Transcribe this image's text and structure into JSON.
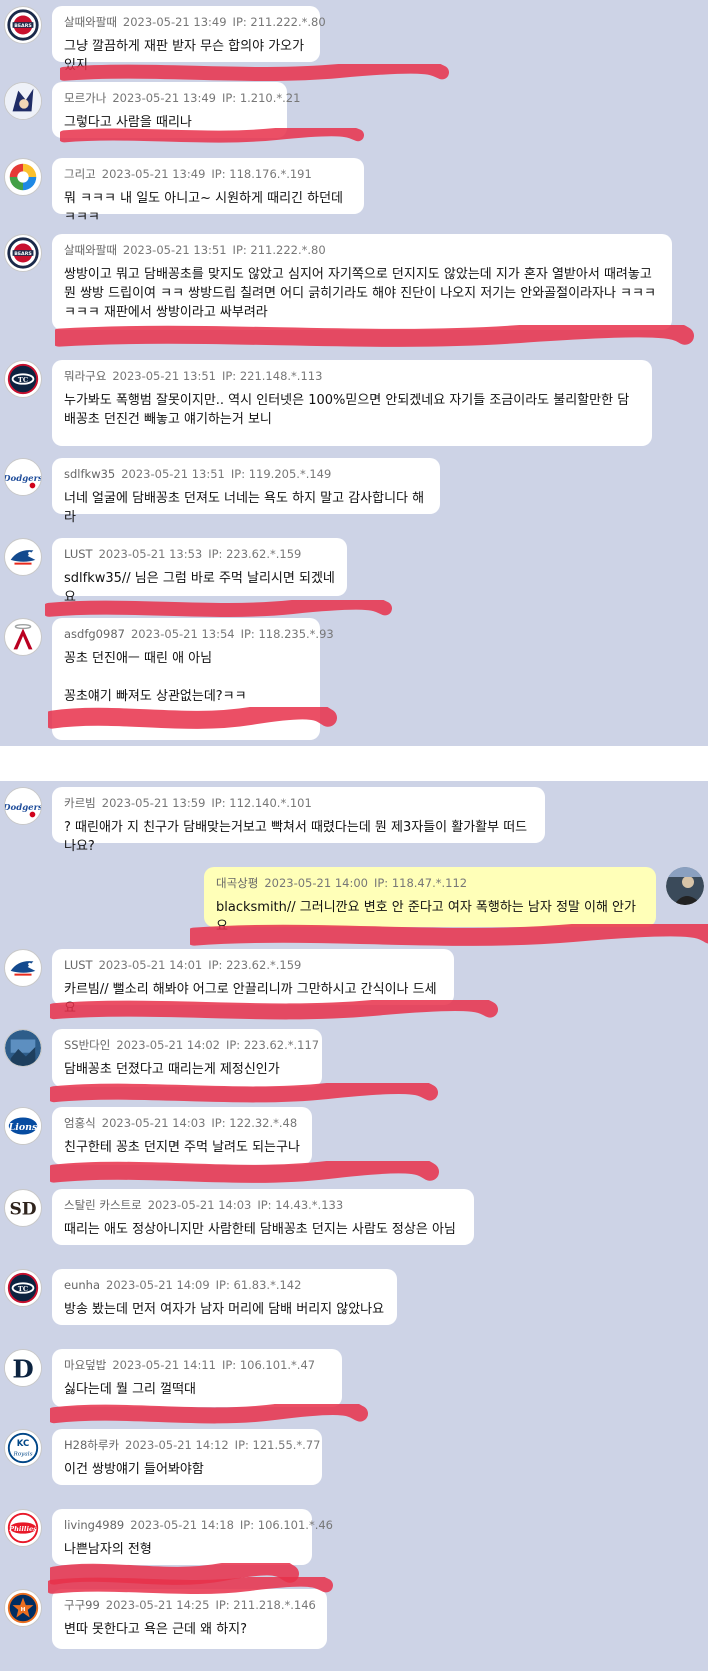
{
  "panels": [
    {
      "messages": [
        {
          "nickname": "살때와팔때",
          "datetime": "2023-05-21 13:49",
          "ip": "IP: 211.222.*.80",
          "text": "그냥 깔끔하게 재판 받자 무슨 합의야 가오가 있지",
          "team_icon": "bears-logo-icon"
        },
        {
          "nickname": "모르가나",
          "datetime": "2023-05-21 13:49",
          "ip": "IP: 1.210.*.21",
          "text": "그렇다고 사람을 때리나",
          "team_icon": "character-avatar-icon"
        },
        {
          "nickname": "그리고",
          "datetime": "2023-05-21 13:49",
          "ip": "IP: 118.176.*.191",
          "text": "뭐 ㅋㅋㅋ 내 일도 아니고~ 시원하게 때리긴 하던데 ㅋㅋㅋ",
          "team_icon": "wbc-logo-icon"
        },
        {
          "nickname": "살때와팔때",
          "datetime": "2023-05-21 13:51",
          "ip": "IP: 211.222.*.80",
          "text": "쌍방이고 뭐고 담배꽁초를 맞지도 않았고 심지어 자기쪽으로 던지지도 않았는데 지가 혼자 열받아서 때려놓고 뭔 쌍방 드립이여 ㅋㅋ 쌍방드립 칠려면 어디 긁히기라도 해야 진단이 나오지 저기는 안와골절이라자나 ㅋㅋㅋㅋㅋㅋ 재판에서 쌍방이라고 싸부려라",
          "team_icon": "bears-logo-icon"
        },
        {
          "nickname": "뭐라구요",
          "datetime": "2023-05-21 13:51",
          "ip": "IP: 221.148.*.113",
          "text": "누가봐도 폭행범 잘못이지만.. 역시 인터넷은 100%믿으면 안되겠네요 자기들 조금이라도 불리할만한 담배꽁초 던진건 빼놓고 얘기하는거 보니",
          "team_icon": "twins-logo-icon"
        },
        {
          "nickname": "sdlfkw35",
          "datetime": "2023-05-21 13:51",
          "ip": "IP: 119.205.*.149",
          "text": "너네 얼굴에 담배꽁초 던져도 너네는 욕도 하지 말고 감사합니다 해라",
          "team_icon": "dodgers-logo-icon"
        },
        {
          "nickname": "LUST",
          "datetime": "2023-05-21 13:53",
          "ip": "IP: 223.62.*.159",
          "text": "sdlfkw35// 님은 그럼 바로 주먹 날리시면 되겠네요",
          "team_icon": "bluejays-logo-icon"
        },
        {
          "nickname": "asdfg0987",
          "datetime": "2023-05-21 13:54",
          "ip": "IP: 118.235.*.93",
          "text": "꽁초 던진애ㅡ 때린 애 아님\n\n꽁초얘기 빠져도 상관없는데?ㅋㅋ",
          "team_icon": "angels-logo-icon"
        }
      ]
    },
    {
      "messages": [
        {
          "nickname": "카르빔",
          "datetime": "2023-05-21 13:59",
          "ip": "IP: 112.140.*.101",
          "text": "? 때린애가 지 친구가 담배맞는거보고 빡쳐서 때렸다는데 뭔 제3자들이 활가활부 떠드나요?",
          "team_icon": "dodgers-logo-icon"
        },
        {
          "nickname": "대곡상평",
          "datetime": "2023-05-21 14:00",
          "ip": "IP: 118.47.*.112",
          "text": "blacksmith// 그러니깐요 변호 안 준다고 여자 폭행하는 남자 정말 이해 안가요",
          "team_icon": "user-photo-avatar",
          "mine": true
        },
        {
          "nickname": "LUST",
          "datetime": "2023-05-21 14:01",
          "ip": "IP: 223.62.*.159",
          "text": "카르빔// 뻘소리 해봐야 어그로 안끌리니까 그만하시고 간식이나 드세요",
          "team_icon": "bluejays-logo-icon"
        },
        {
          "nickname": "SS반다인",
          "datetime": "2023-05-21 14:02",
          "ip": "IP: 223.62.*.117",
          "text": "담배꽁초 던졌다고 때리는게 제정신인가",
          "team_icon": "photo-avatar-icon"
        },
        {
          "nickname": "엄홍식",
          "datetime": "2023-05-21 14:03",
          "ip": "IP: 122.32.*.48",
          "text": "친구한테 꽁초 던지면 주먹 날려도 되는구나",
          "team_icon": "lions-logo-icon"
        },
        {
          "nickname": "스탈린 카스트로",
          "datetime": "2023-05-21 14:03",
          "ip": "IP: 14.43.*.133",
          "text": "때리는 애도 정상아니지만 사람한테 담배꽁초 던지는 사람도 정상은 아님",
          "team_icon": "padres-logo-icon"
        },
        {
          "nickname": "eunha",
          "datetime": "2023-05-21 14:09",
          "ip": "IP: 61.83.*.142",
          "text": "방송 봤는데 먼저 여자가 남자 머리에 담배 버리지 않았나요",
          "team_icon": "twins-logo-icon"
        },
        {
          "nickname": "마요덮밥",
          "datetime": "2023-05-21 14:11",
          "ip": "IP: 106.101.*.47",
          "text": "싫다는데 뭘 그리 껄떡대",
          "team_icon": "tigers-logo-icon"
        },
        {
          "nickname": "H28하루카",
          "datetime": "2023-05-21 14:12",
          "ip": "IP: 121.55.*.77",
          "text": "이건 쌍방얘기 들어봐야함",
          "team_icon": "royals-logo-icon"
        },
        {
          "nickname": "living4989",
          "datetime": "2023-05-21 14:18",
          "ip": "IP: 106.101.*.46",
          "text": "나쁜남자의 전형",
          "team_icon": "phillies-logo-icon"
        },
        {
          "nickname": "구구99",
          "datetime": "2023-05-21 14:25",
          "ip": "IP: 211.218.*.146",
          "text": "변따 못한다고 욕은 근데 왜 하지?",
          "team_icon": "astros-logo-icon"
        }
      ]
    }
  ],
  "colors": {
    "panel_bg": "#cdd3e6",
    "bubble": "#ffffff",
    "bubble_mine": "#ffffb8",
    "redact_marker": "#e8304a"
  }
}
